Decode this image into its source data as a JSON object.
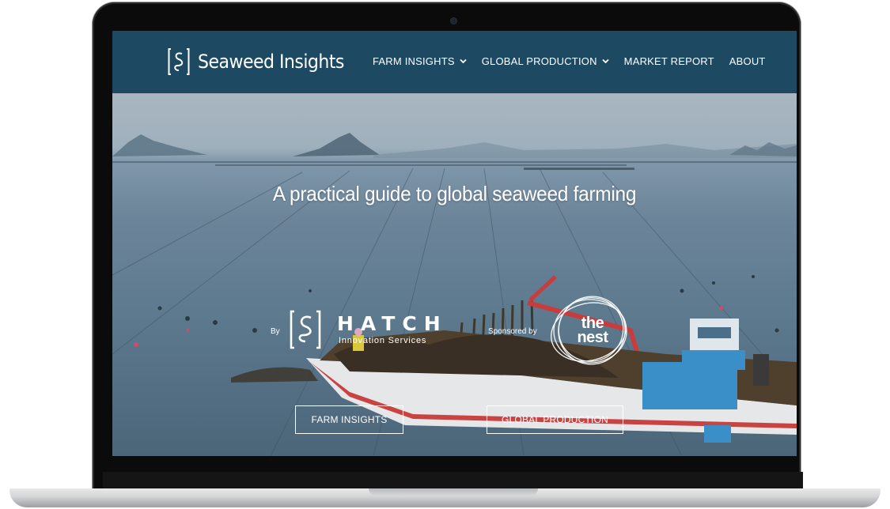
{
  "site": {
    "name": "Seaweed Insights"
  },
  "nav": {
    "items": [
      {
        "label": "FARM INSIGHTS",
        "has_dropdown": true
      },
      {
        "label": "GLOBAL PRODUCTION",
        "has_dropdown": true
      },
      {
        "label": "MARKET REPORT",
        "has_dropdown": false
      },
      {
        "label": "ABOUT",
        "has_dropdown": false
      }
    ]
  },
  "hero": {
    "headline": "A practical guide to global seaweed farming",
    "by_label": "By",
    "partner": {
      "name": "HATCH",
      "subtitle": "Innovation Services"
    },
    "sponsored_label": "Sponsored by",
    "sponsor": {
      "line1": "the",
      "line2": "nest"
    },
    "buttons": {
      "farm_insights": "FARM INSIGHTS",
      "global_production": "GLOBAL PRODUCTION"
    }
  },
  "colors": {
    "nav_background": "#1d4963",
    "text": "#ffffff",
    "boat_hull": "#e8e8e8",
    "boat_stripe": "#c84040",
    "cabin": "#3b8fc9"
  },
  "icons": {
    "logo": "seaweed-hook-logo-icon",
    "dropdown": "chevron-down-icon",
    "partner": "hatch-logo-icon",
    "sponsor": "the-nest-logo-icon"
  }
}
